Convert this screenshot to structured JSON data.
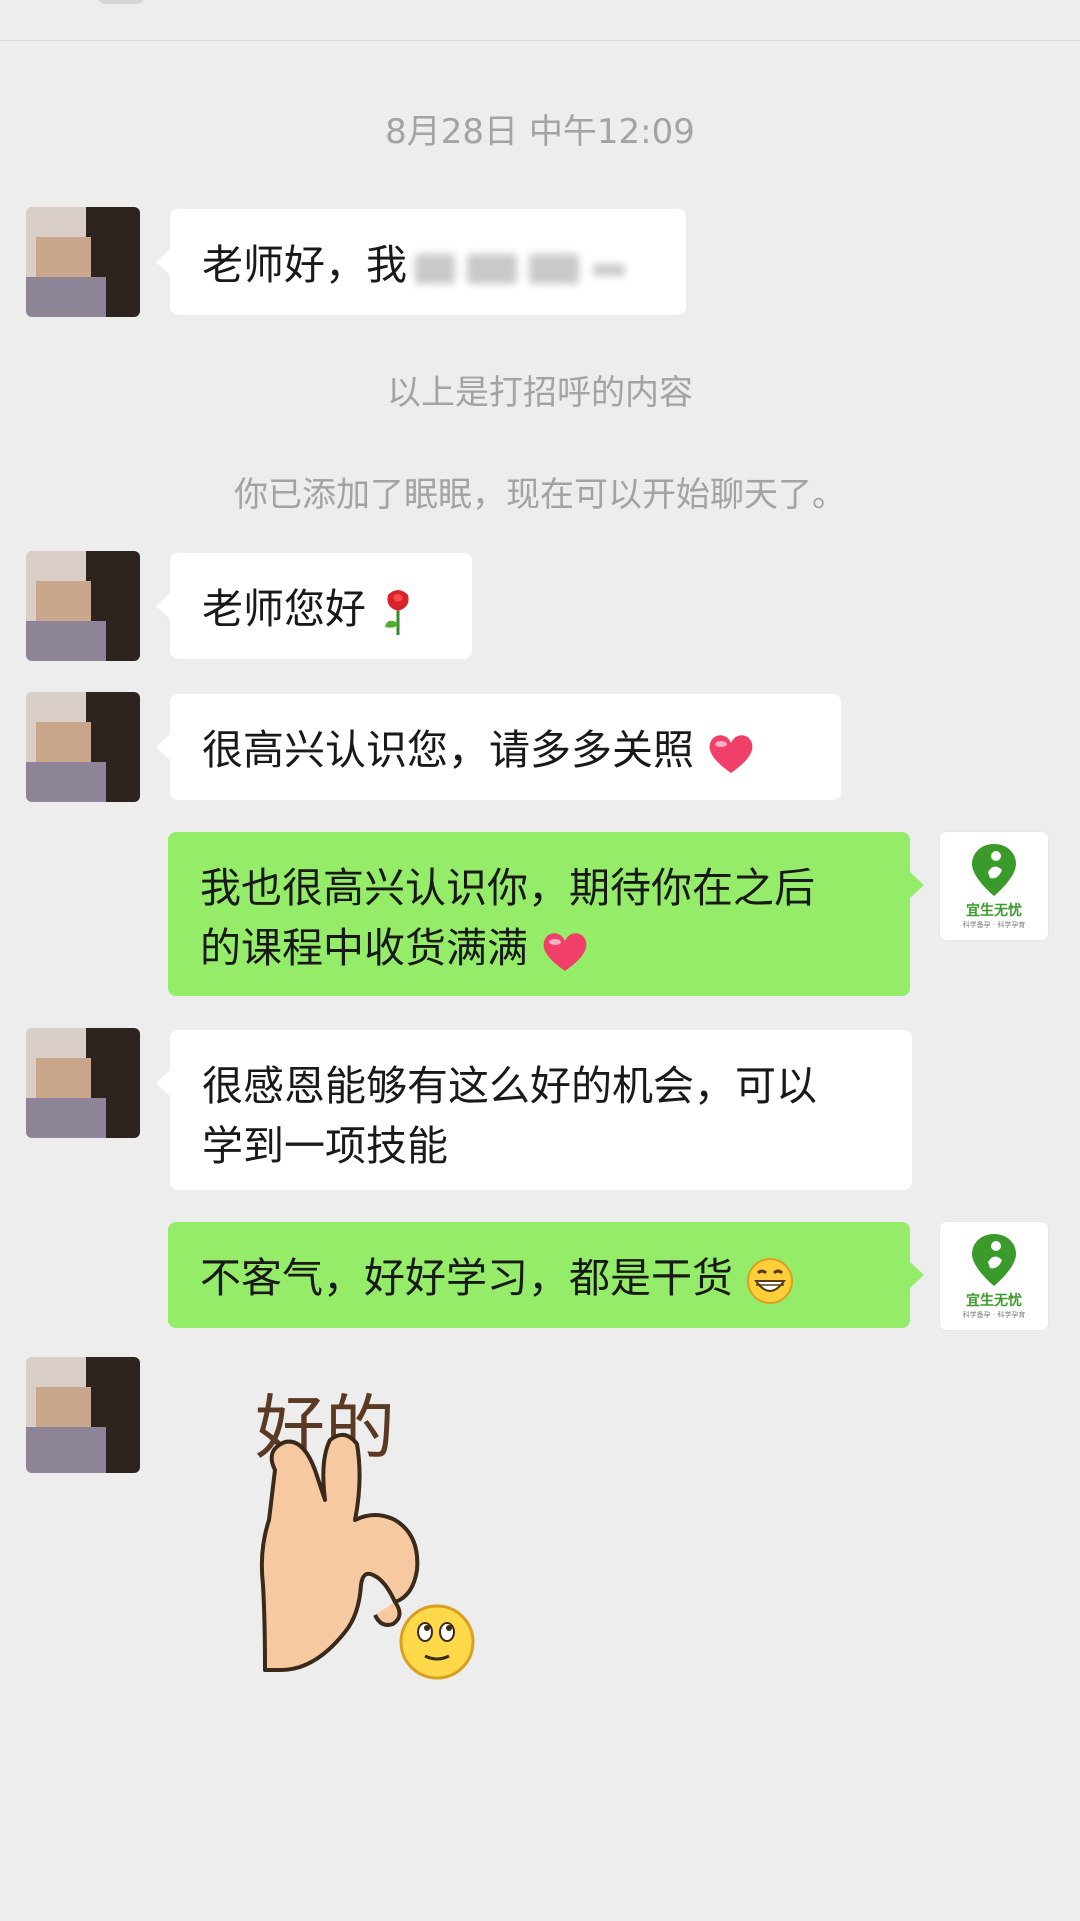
{
  "timestamp": "8月28日 中午12:09",
  "system_messages": {
    "greeting_note": "以上是打招呼的内容",
    "added_note": "你已添加了眠眠，现在可以开始聊天了。"
  },
  "messages": [
    {
      "side": "left",
      "text_prefix": "老师好，我",
      "redacted": true
    },
    {
      "side": "left",
      "text": "老师您好",
      "emoji": "rose"
    },
    {
      "side": "left",
      "text": "很高兴认识您，请多多关照",
      "emoji": "heart"
    },
    {
      "side": "right",
      "line1": "我也很高兴认识你，期待你在之后",
      "line2": "的课程中收货满满",
      "emoji": "heart"
    },
    {
      "side": "left",
      "line1": "很感恩能够有这么好的机会，可以",
      "line2": "学到一项技能"
    },
    {
      "side": "right",
      "text": "不客气，好好学习，都是干货",
      "emoji": "grin"
    },
    {
      "side": "left",
      "sticker_text": "好的",
      "sticker": "ok-hand-sticker"
    }
  ],
  "self_avatar": {
    "brand": "宜生无忧",
    "tagline": "科学备孕 · 科学孕育"
  },
  "colors": {
    "background": "#ededed",
    "incoming_bubble": "#ffffff",
    "outgoing_bubble": "#95ec69",
    "system_text": "#a3a3a3",
    "brand_green": "#3a9a2a"
  }
}
